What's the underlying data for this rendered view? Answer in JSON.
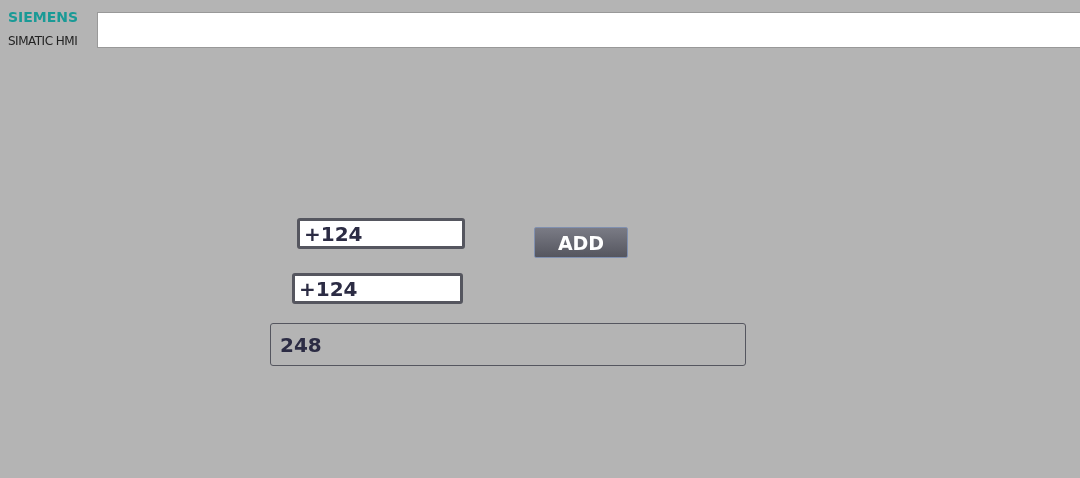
{
  "header": {
    "brand": "SIEMENS",
    "product": "SIMATIC HMI"
  },
  "inputs": [
    {
      "value": "+124"
    },
    {
      "value": "+124"
    }
  ],
  "button": {
    "label": "ADD"
  },
  "output": {
    "value": "248"
  }
}
